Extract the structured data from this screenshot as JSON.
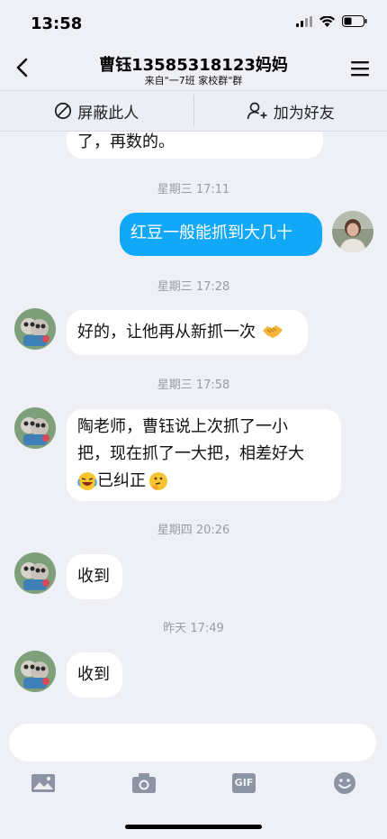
{
  "status_bar": {
    "time": "13:58"
  },
  "nav": {
    "title": "曹钰13585318123妈妈",
    "subtitle": "来自\"一7班 家校群\"群"
  },
  "actions": {
    "block_label": "屏蔽此人",
    "add_friend_label": "加为好友"
  },
  "messages": [
    {
      "type": "text",
      "sender": "other",
      "text": "了，再数的。"
    },
    {
      "type": "time",
      "text": "星期三 17:11"
    },
    {
      "type": "text",
      "sender": "self",
      "text": "红豆一般能抓到大几十"
    },
    {
      "type": "time",
      "text": "星期三 17:28"
    },
    {
      "type": "text",
      "sender": "other",
      "text": "好的，让他再从新抓一次"
    },
    {
      "type": "time",
      "text": "星期三 17:58"
    },
    {
      "type": "text",
      "sender": "other",
      "line1": "陶老师，曹钰说上次抓了一小",
      "line2": "把，现在抓了一大把，相差好大",
      "line3": "已纠正"
    },
    {
      "type": "time",
      "text": "星期四 20:26"
    },
    {
      "type": "text",
      "sender": "other",
      "text": "收到"
    },
    {
      "type": "time",
      "text": "昨天 17:49"
    },
    {
      "type": "text",
      "sender": "other",
      "text": "收到"
    }
  ],
  "toolbar": {
    "icons": [
      "image-icon",
      "camera-icon",
      "gif-icon",
      "emoji-icon"
    ],
    "gif_label": "GIF"
  },
  "colors": {
    "self_bubble": "#12a8f8",
    "background": "#eef0f6"
  }
}
